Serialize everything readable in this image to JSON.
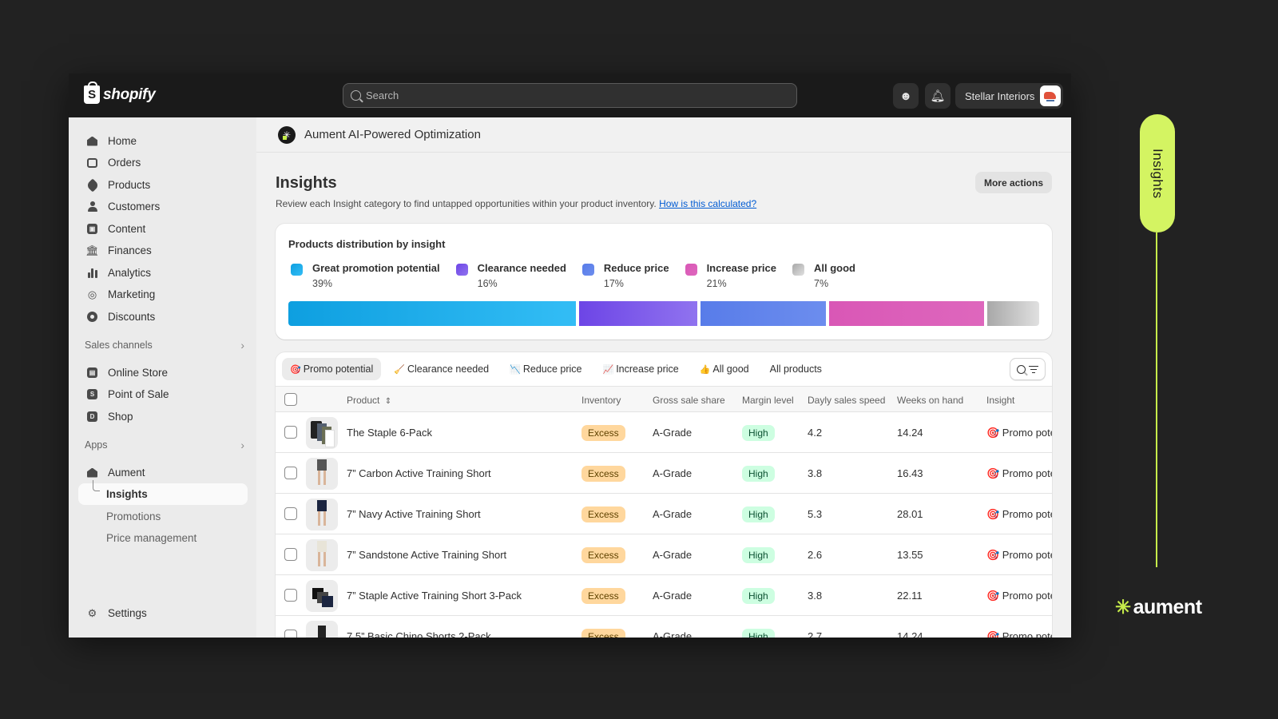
{
  "topbar": {
    "logo_text": "shopify",
    "search_placeholder": "Search",
    "store_name": "Stellar Interiors"
  },
  "sidebar": {
    "main_items": [
      {
        "label": "Home",
        "icon": "home-icon"
      },
      {
        "label": "Orders",
        "icon": "inbox-icon"
      },
      {
        "label": "Products",
        "icon": "tag-icon"
      },
      {
        "label": "Customers",
        "icon": "person-icon"
      },
      {
        "label": "Content",
        "icon": "image-icon"
      },
      {
        "label": "Finances",
        "icon": "bank-icon"
      },
      {
        "label": "Analytics",
        "icon": "bar-chart-icon"
      },
      {
        "label": "Marketing",
        "icon": "target-icon"
      },
      {
        "label": "Discounts",
        "icon": "discount-icon"
      }
    ],
    "sales_channels_label": "Sales channels",
    "sales_channels": [
      {
        "label": "Online Store",
        "icon": "store-icon"
      },
      {
        "label": "Point of Sale",
        "icon": "pos-icon"
      },
      {
        "label": "Shop",
        "icon": "shop-icon"
      }
    ],
    "apps_label": "Apps",
    "apps": [
      {
        "label": "Aument",
        "icon": "home-icon"
      },
      {
        "label": "Insights",
        "active": true
      },
      {
        "label": "Promotions"
      },
      {
        "label": "Price management"
      }
    ],
    "settings_label": "Settings"
  },
  "app_header": {
    "title": "Aument AI-Powered Optimization"
  },
  "page": {
    "title": "Insights",
    "description": "Review each Insight category to find untapped opportunities within your product inventory.",
    "help_link": "How is this calculated?",
    "more_actions": "More actions"
  },
  "distribution": {
    "title": "Products distribution by insight",
    "categories": [
      {
        "name": "Great promotion potential",
        "pct_label": "39%",
        "value": 39,
        "color_from": "#0e9fe0",
        "color_to": "#33bdf5"
      },
      {
        "name": "Clearance needed",
        "pct_label": "16%",
        "value": 16,
        "color_from": "#6d45e6",
        "color_to": "#9073ef"
      },
      {
        "name": "Reduce price",
        "pct_label": "17%",
        "value": 17,
        "color_from": "#587ce9",
        "color_to": "#6c8dee"
      },
      {
        "name": "Increase price",
        "pct_label": "21%",
        "value": 21,
        "color_from": "#d957b6",
        "color_to": "#de67bd"
      },
      {
        "name": "All good",
        "pct_label": "7%",
        "value": 7,
        "color_from": "#a8a8a8",
        "color_to": "#e0e0e0"
      }
    ]
  },
  "tabs": [
    {
      "label": "Promo potential",
      "emoji": "🎯",
      "active": true
    },
    {
      "label": "Clearance needed",
      "emoji": "🧹"
    },
    {
      "label": "Reduce price",
      "emoji": "📉"
    },
    {
      "label": "Increase price",
      "emoji": "📈"
    },
    {
      "label": "All good",
      "emoji": "👍"
    },
    {
      "label": "All products",
      "emoji": ""
    }
  ],
  "table": {
    "columns": [
      "Product",
      "Inventory",
      "Gross sale share",
      "Margin level",
      "Dayly sales speed",
      "Weeks on hand",
      "Insight"
    ],
    "rows": [
      {
        "product": "The Staple 6-Pack",
        "inventory": "Excess",
        "gross_share": "A-Grade",
        "margin": "High",
        "speed": "4.2",
        "weeks": "14.24",
        "insight": "🎯 Promo potential"
      },
      {
        "product": "7” Carbon Active Training Short",
        "inventory": "Excess",
        "gross_share": "A-Grade",
        "margin": "High",
        "speed": "3.8",
        "weeks": "16.43",
        "insight": "🎯 Promo potential"
      },
      {
        "product": "7” Navy Active Training Short",
        "inventory": "Excess",
        "gross_share": "A-Grade",
        "margin": "High",
        "speed": "5.3",
        "weeks": "28.01",
        "insight": "🎯 Promo potential"
      },
      {
        "product": "7” Sandstone Active Training Short",
        "inventory": "Excess",
        "gross_share": "A-Grade",
        "margin": "High",
        "speed": "2.6",
        "weeks": "13.55",
        "insight": "🎯 Promo potential"
      },
      {
        "product": "7” Staple Active Training Short 3-Pack",
        "inventory": "Excess",
        "gross_share": "A-Grade",
        "margin": "High",
        "speed": "3.8",
        "weeks": "22.11",
        "insight": "🎯 Promo potential"
      },
      {
        "product": "7.5” Basic Chino Shorts 2-Pack",
        "inventory": "Excess",
        "gross_share": "A-Grade",
        "margin": "High",
        "speed": "2.7",
        "weeks": "14.24",
        "insight": "🎯 Promo potential"
      }
    ]
  },
  "decoration": {
    "pill_label": "Insights",
    "brand_name": "aument",
    "accent_color": "#d4f462"
  }
}
